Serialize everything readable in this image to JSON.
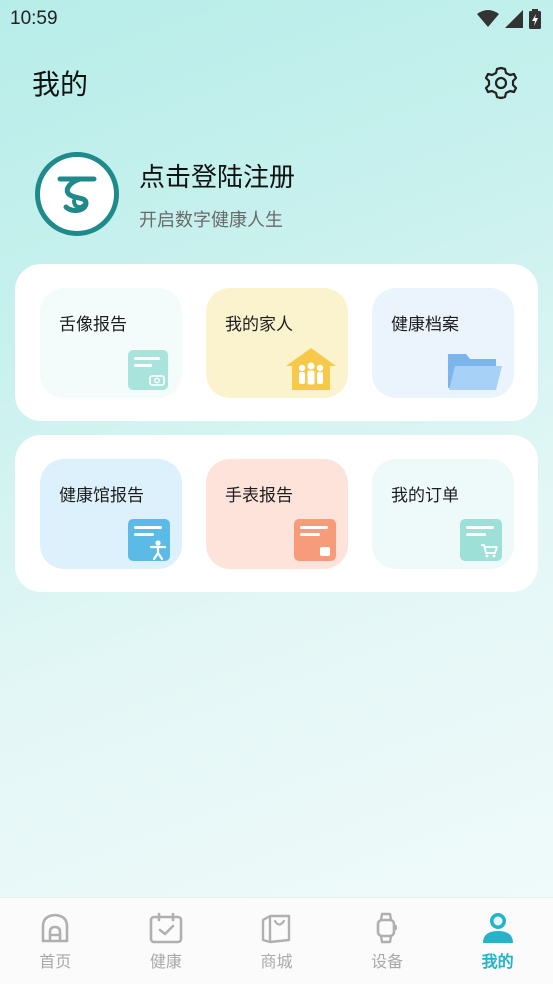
{
  "status_bar": {
    "time": "10:59"
  },
  "header": {
    "title": "我的"
  },
  "profile": {
    "login_text": "点击登陆注册",
    "subtitle": "开启数字健康人生"
  },
  "cards": [
    {
      "tiles": [
        {
          "label": "舌像报告",
          "icon": "tongue-report-icon"
        },
        {
          "label": "我的家人",
          "icon": "family-house-icon"
        },
        {
          "label": "健康档案",
          "icon": "folder-icon"
        }
      ]
    },
    {
      "tiles": [
        {
          "label": "健康馆报告",
          "icon": "health-hall-report-icon"
        },
        {
          "label": "手表报告",
          "icon": "watch-report-icon"
        },
        {
          "label": "我的订单",
          "icon": "shopping-cart-icon"
        }
      ]
    }
  ],
  "tabbar": {
    "active": "我的",
    "items": [
      {
        "label": "首页",
        "icon": "home-icon"
      },
      {
        "label": "健康",
        "icon": "calendar-check-icon"
      },
      {
        "label": "商城",
        "icon": "shopping-bag-icon"
      },
      {
        "label": "设备",
        "icon": "watch-icon"
      },
      {
        "label": "我的",
        "icon": "user-icon"
      }
    ]
  },
  "colors": {
    "accent": "#25b3c8",
    "inactive_tab": "#a9a9a9",
    "avatar_ring": "#1e8a8a"
  }
}
